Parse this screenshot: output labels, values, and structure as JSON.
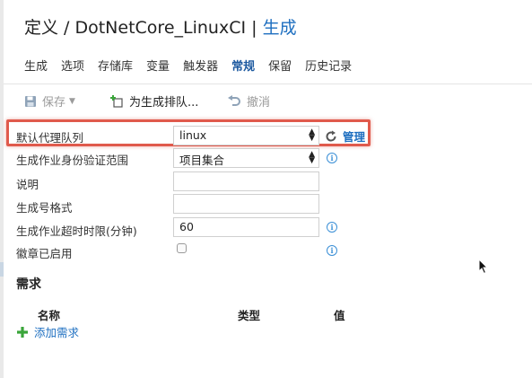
{
  "header": {
    "title_prefix": "定义 / DotNetCore_LinuxCI |",
    "title_active": "生成"
  },
  "tabs": [
    {
      "label": "生成"
    },
    {
      "label": "选项"
    },
    {
      "label": "存储库"
    },
    {
      "label": "变量"
    },
    {
      "label": "触发器"
    },
    {
      "label": "常规"
    },
    {
      "label": "保留"
    },
    {
      "label": "历史记录"
    }
  ],
  "toolbar": {
    "save_label": "保存",
    "queue_label": "为生成排队...",
    "undo_label": "撤消"
  },
  "form": {
    "queue_label": "默认代理队列",
    "queue_value": "linux",
    "manage_label": "管理",
    "scope_label": "生成作业身份验证范围",
    "scope_value": "项目集合",
    "description_label": "说明",
    "description_value": "",
    "build_number_label": "生成号格式",
    "build_number_value": "",
    "timeout_label": "生成作业超时时限(分钟)",
    "timeout_value": "60",
    "badge_label": "徽章已启用",
    "badge_enabled": false
  },
  "demands": {
    "title": "需求",
    "col_name": "名称",
    "col_type": "类型",
    "col_value": "值",
    "add_label": "添加需求"
  },
  "colors": {
    "accent": "#1e6fc0",
    "highlight": "#e05a4c",
    "add_green": "#3aa53a"
  }
}
